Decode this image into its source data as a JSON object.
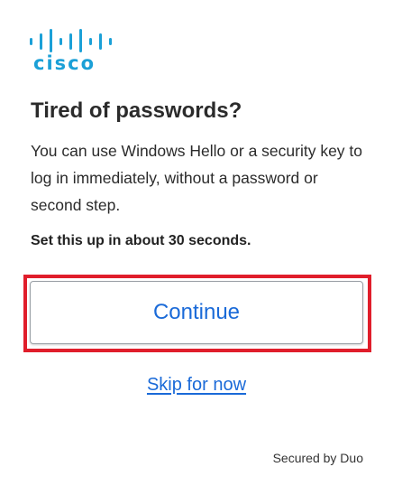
{
  "brand": {
    "name": "cisco",
    "color": "#1ba0d7"
  },
  "title": "Tired of passwords?",
  "description": "You can use Windows Hello or a security key to log in immediately, without a password or second step.",
  "setup_note": "Set this up in about 30 seconds.",
  "continue_label": "Continue",
  "skip_label": "Skip for now",
  "footer": "Secured by Duo",
  "colors": {
    "accent": "#1a6ad8",
    "highlight_border": "#e01e2b"
  }
}
